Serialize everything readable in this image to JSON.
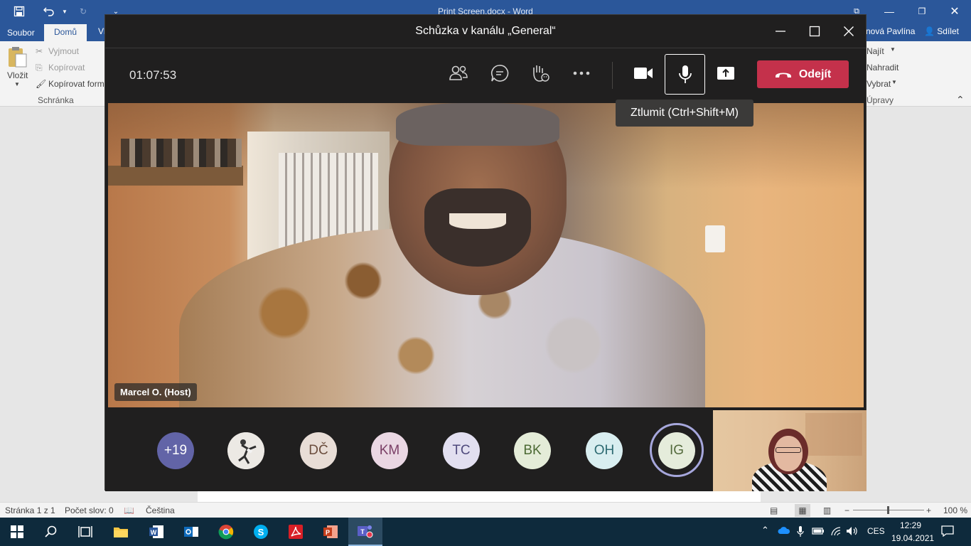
{
  "word": {
    "title": "Print Screen.docx - Word",
    "tabs": {
      "file": "Soubor",
      "home": "Domů",
      "partial": "Vl"
    },
    "user": "nová Pavlína",
    "share": "Sdílet",
    "clipboard": {
      "paste": "Vložit",
      "cut": "Vyjmout",
      "copy": "Kopírovat",
      "format_painter": "Kopírovat form",
      "group": "Schránka"
    },
    "editing": {
      "find": "Najít",
      "replace": "Nahradit",
      "select": "Vybrat",
      "group": "Úpravy"
    },
    "status": {
      "page": "Stránka 1 z 1",
      "words": "Počet slov: 0",
      "language": "Čeština",
      "zoom": "100 %"
    }
  },
  "teams": {
    "title": "Schůzka v kanálu „General“",
    "timer": "01:07:53",
    "leave_label": "Odejít",
    "tooltip": "Ztlumit (Ctrl+Shift+M)",
    "speaker_name": "Marcel O. (Host)",
    "participants": [
      {
        "initials": "+19",
        "bg": "#6264a7",
        "color": "#ffffff"
      },
      {
        "initials": "",
        "bg": "#e9e6e1",
        "color": "#5a5a5a"
      },
      {
        "initials": "DČ",
        "bg": "#e8ddd6",
        "color": "#6b4d3d"
      },
      {
        "initials": "KM",
        "bg": "#ead7e3",
        "color": "#7a3f66"
      },
      {
        "initials": "TC",
        "bg": "#e2dff0",
        "color": "#4f4a7d"
      },
      {
        "initials": "BK",
        "bg": "#e4ecd8",
        "color": "#4c6a34"
      },
      {
        "initials": "OH",
        "bg": "#d9eef0",
        "color": "#2d6a72"
      },
      {
        "initials": "IG",
        "bg": "#e5ecdb",
        "color": "#536a3c"
      }
    ],
    "colors": {
      "leave": "#c4314b",
      "bg": "#201f1f",
      "ring": "#a6a7dc"
    }
  },
  "taskbar": {
    "language": "CES",
    "time": "12:29",
    "date": "19.04.2021",
    "apps": [
      "start-icon",
      "search-icon",
      "task-view-icon",
      "file-explorer-icon",
      "word-icon",
      "outlook-icon",
      "chrome-icon",
      "skype-icon",
      "acrobat-icon",
      "powerpoint-icon",
      "teams-icon"
    ]
  }
}
